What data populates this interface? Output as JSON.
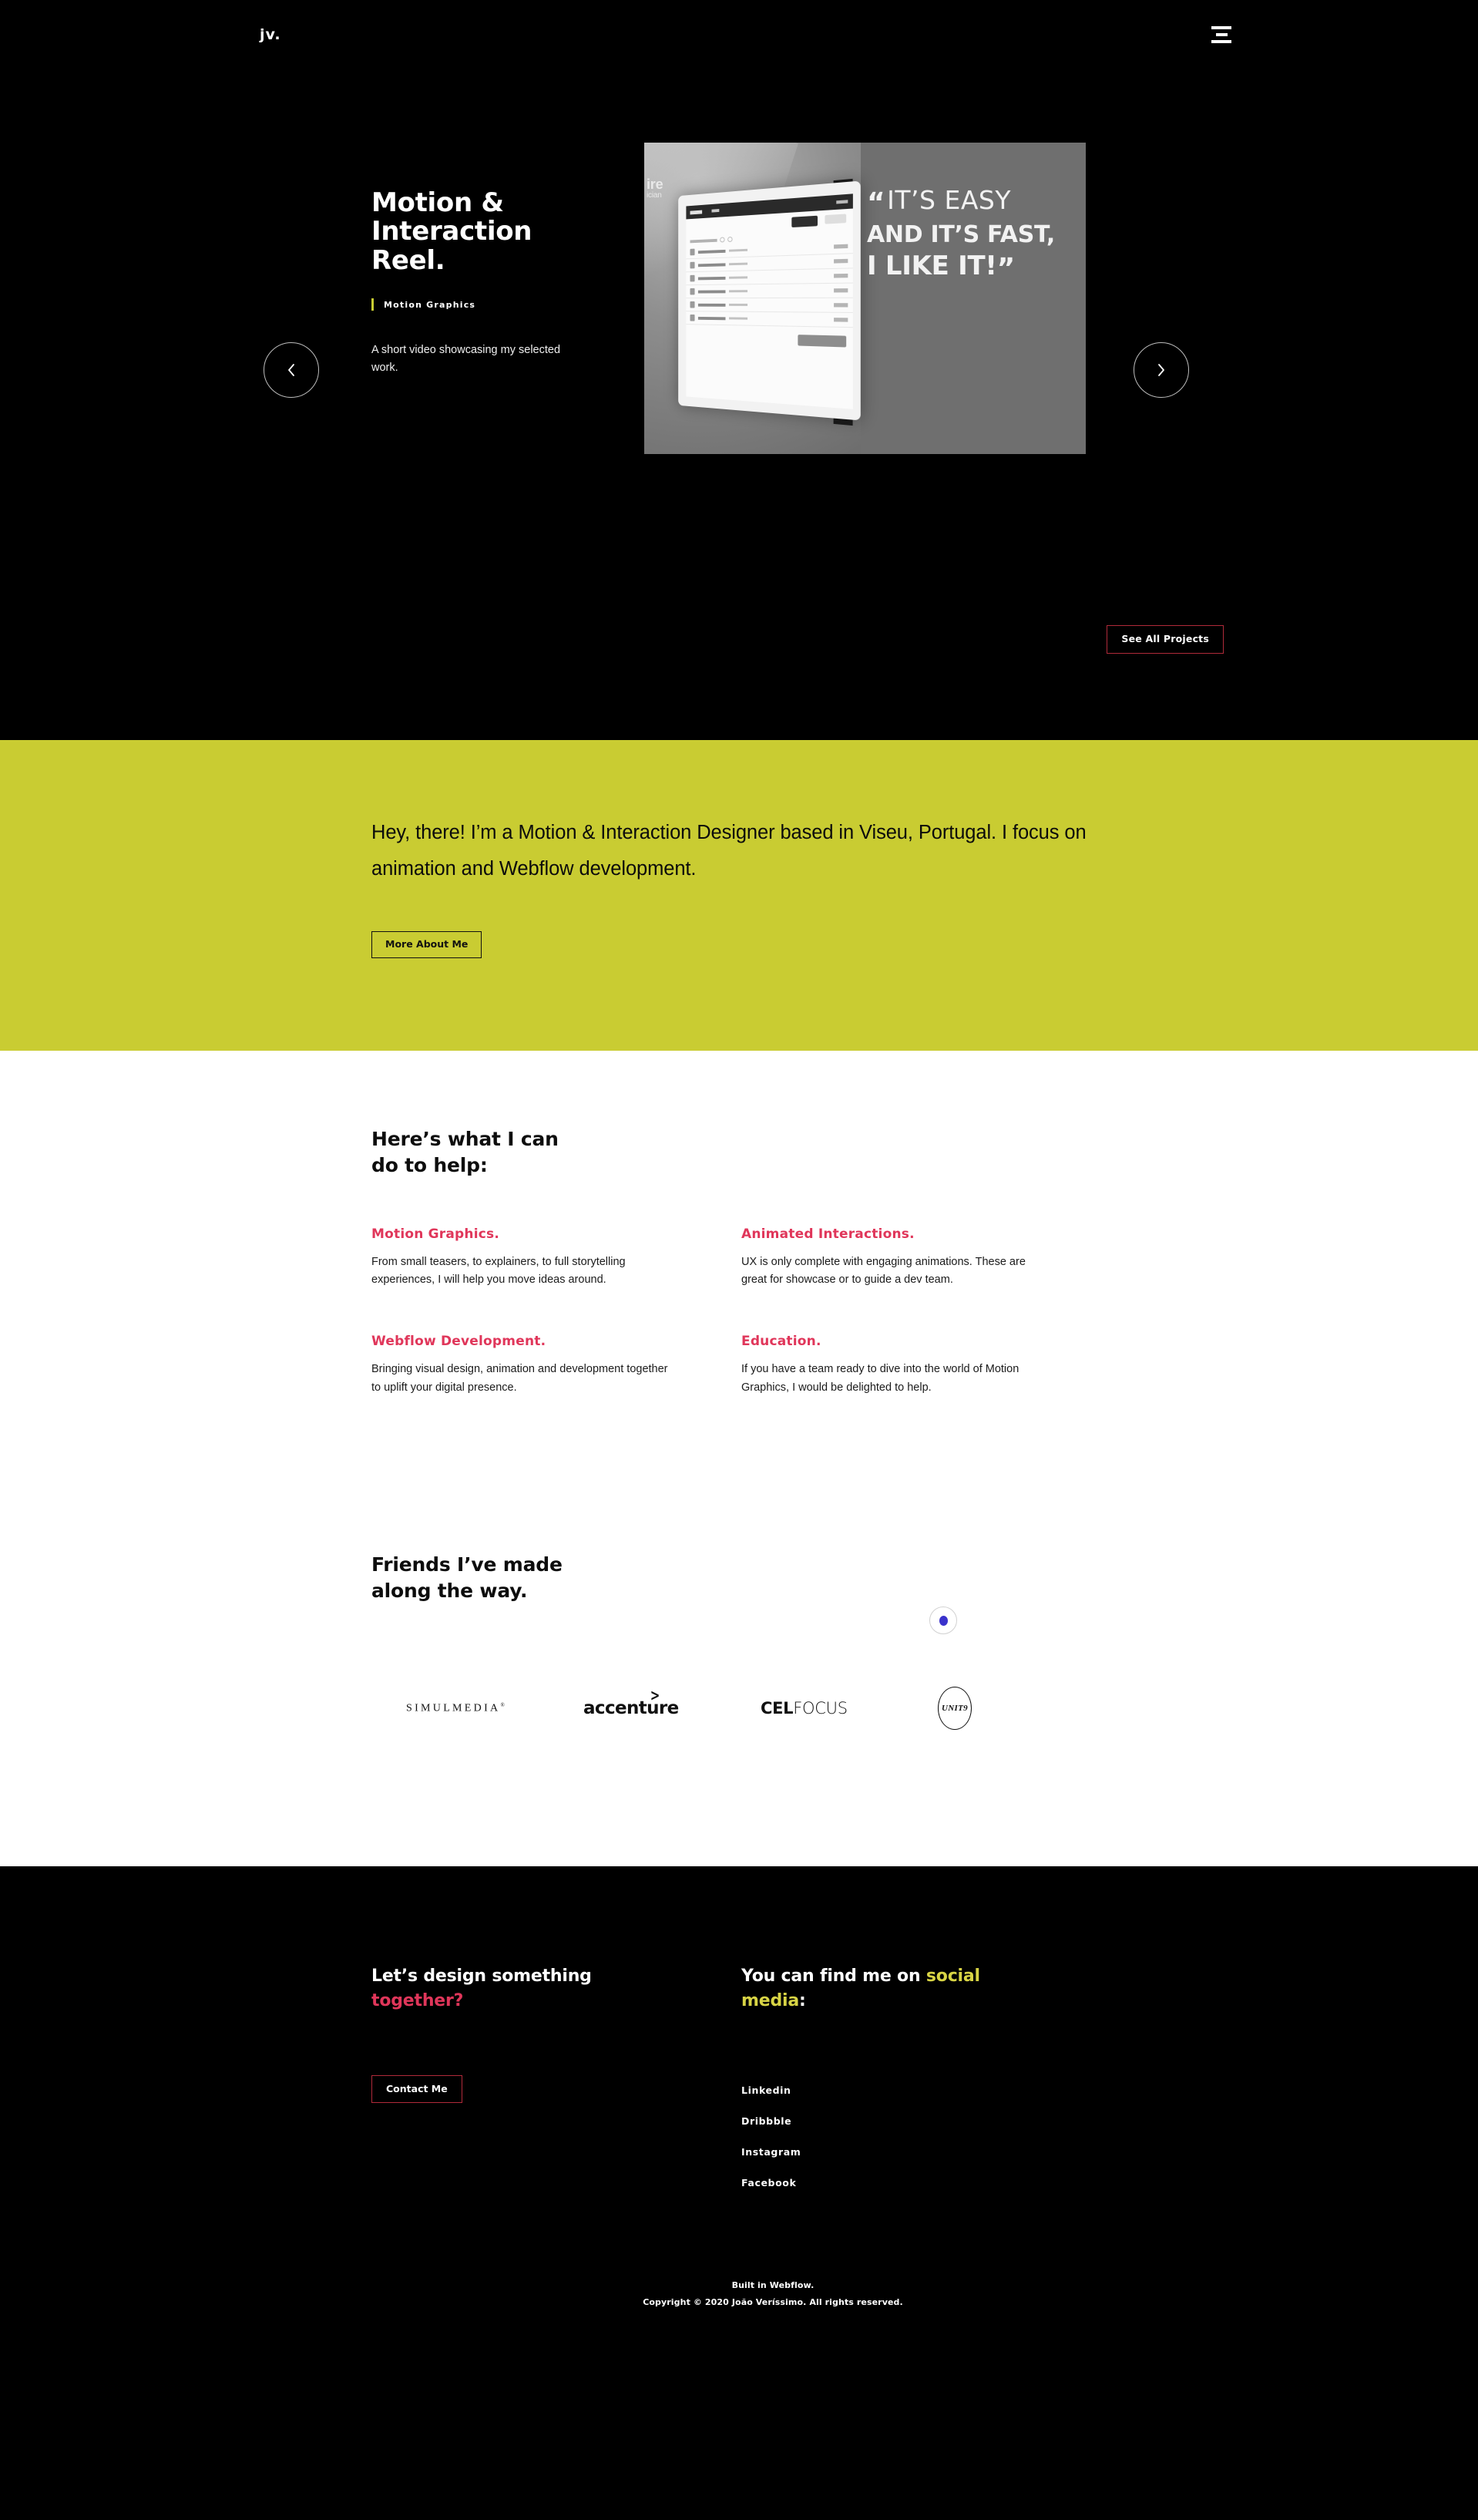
{
  "nav": {
    "logo": "jv.",
    "menu_icon": "hamburger-icon"
  },
  "hero": {
    "slide": {
      "title": "Motion & Interaction Reel.",
      "category": "Motion Graphics",
      "description": "A short video showcasing my selected work.",
      "media": {
        "type": "video-still",
        "grayscale": true,
        "quote_line1": "IT’S EASY",
        "quote_line2": "AND IT’S FAST,",
        "quote_line3": "I LIKE IT!",
        "quote_open_mark": "“",
        "quote_close_mark": "”",
        "wall_logo": "ire",
        "wall_logo_sub": "ician"
      }
    },
    "prev_label": "Previous project",
    "next_label": "Next project",
    "see_all_label": "See All Projects"
  },
  "intro": {
    "text": "Hey, there! I’m a Motion & Interaction Designer based in Viseu, Portugal. I focus on animation and Webflow development.",
    "button_label": "More About Me",
    "bg_color": "#c9cc32",
    "cursor": {
      "color": "#3a32cc"
    }
  },
  "services": {
    "heading": "Here’s what I can\ndo to help:",
    "accent_color": "#e0365a",
    "items": [
      {
        "title": "Motion Graphics.",
        "body": "From small teasers, to explainers, to full storytelling experiences, I will help you move ideas around."
      },
      {
        "title": "Animated Interactions.",
        "body": "UX is only complete with engaging animations. These are great for showcase or to guide a dev team."
      },
      {
        "title": "Webflow Development.",
        "body": "Bringing visual design, animation and development together to uplift your digital presence."
      },
      {
        "title": "Education.",
        "body": "If you have a team ready to dive into the world of Motion Graphics, I would be delighted to help."
      }
    ]
  },
  "friends": {
    "heading": "Friends I’ve made\nalong the way.",
    "logos": [
      {
        "name": "SIMULMEDIA",
        "mark": "®"
      },
      {
        "name": "accenture",
        "mark": ">"
      },
      {
        "name_bold": "CEL",
        "name_light": "FOCUS"
      },
      {
        "name": "UNIT9"
      }
    ]
  },
  "footer": {
    "cta_line1": "Let’s design something",
    "cta_line2": "together?",
    "contact_label": "Contact Me",
    "social_line1": "You can find me on ",
    "social_highlight1": "social",
    "social_highlight2": "media",
    "social_colon": ":",
    "social_links": [
      "Linkedin",
      "Dribbble",
      "Instagram",
      "Facebook"
    ],
    "built": "Built in Webflow.",
    "copyright": "Copyright © 2020 João Veríssimo. All rights reserved.",
    "pink": "#e0365a",
    "yellow": "#d8d445"
  }
}
